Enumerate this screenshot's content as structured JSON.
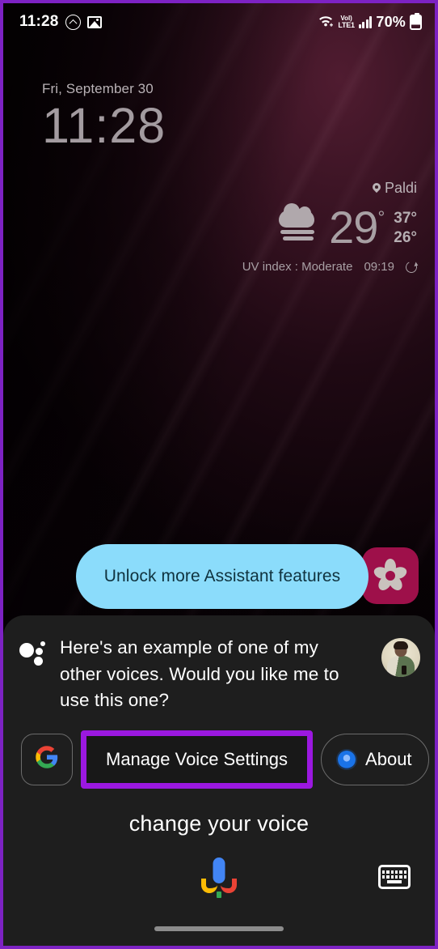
{
  "theme": {
    "accent_highlight": "#9b18e0",
    "chip_blue": "#8bdcfb",
    "sheet_bg": "#1e1e1e",
    "flower_bg": "#9e104a"
  },
  "status_bar": {
    "time": "11:28",
    "icons_left": [
      "circle-up-icon",
      "image-icon"
    ],
    "network": {
      "wifi": "wifi-icon",
      "volte_line1": "VoI)",
      "volte_line2": "LTE1",
      "signal": "signal-bars-icon"
    },
    "battery_percent": "70%"
  },
  "lockscreen": {
    "date": "Fri, September 30",
    "time": "11:28",
    "weather": {
      "location": "Paldi",
      "condition_icon": "fog-cloud-icon",
      "temperature": "29",
      "degree": "°",
      "high": "37°",
      "low": "26°",
      "uv_index": "UV index : Moderate",
      "updated_time": "09:19",
      "refresh_icon": "refresh-icon"
    }
  },
  "suggestion": {
    "unlock_chip_label": "Unlock more Assistant features",
    "flower_icon": "flower-icon"
  },
  "assistant": {
    "response_text": "Here's an example of one of my other voices. Would you like me to use this one?",
    "assistant_icon": "google-assistant-dots-icon",
    "avatar": "user-avatar",
    "actions": [
      {
        "name": "google-logo-chip",
        "label": "G",
        "icon": "google-g-icon",
        "highlighted": false
      },
      {
        "name": "manage-voice-settings-chip",
        "label": "Manage Voice Settings",
        "icon": "",
        "highlighted": true
      },
      {
        "name": "about-chip",
        "label": "About",
        "icon": "blue-circle-icon",
        "highlighted": false
      }
    ],
    "transcript": "change your voice",
    "mic_icon": "google-mic-icon",
    "keyboard_icon": "keyboard-icon"
  }
}
